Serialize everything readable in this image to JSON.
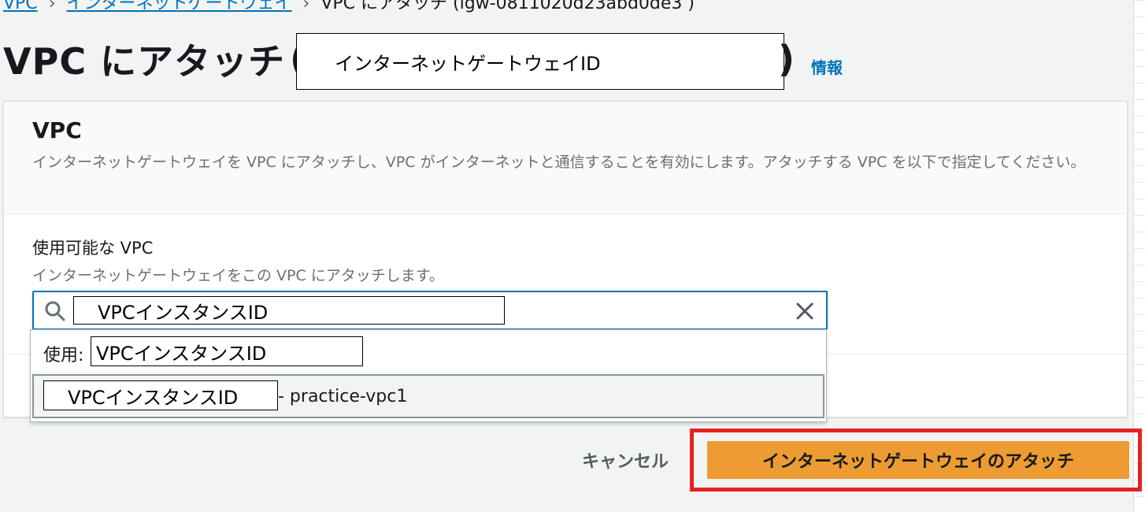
{
  "breadcrumb": {
    "items": [
      "VPC",
      "インターネットゲートウェイ",
      "VPC にアタッチ (igw-0811020d23abd0de3 )"
    ],
    "separator": "›"
  },
  "header": {
    "title": "VPC にアタッチ",
    "open_paren": "(",
    "close_paren": ")",
    "masked_id_label": "インターネットゲートウェイID",
    "info_link": "情報"
  },
  "panel": {
    "title": "VPC",
    "description": "インターネットゲートウェイを VPC にアタッチし、VPC がインターネットと通信することを有効にします。アタッチする VPC を以下で指定してください。",
    "field_label": "使用可能な VPC",
    "field_description": "インターネットゲートウェイをこの VPC にアタッチします。",
    "search_value_mask": "VPCインスタンスID"
  },
  "dropdown": {
    "group_label": "使用:",
    "group_mask": "VPCインスタンスID",
    "option_mask": "VPCインスタンスID",
    "option_suffix": "- practice-vpc1"
  },
  "footer": {
    "cancel_label": "キャンセル",
    "attach_label": "インターネットゲートウェイのアタッチ"
  },
  "colors": {
    "link": "#0073bb",
    "primary_button": "#ec9c32",
    "highlight": "#e52222",
    "focus_border": "#0073bb"
  },
  "icons": {
    "search": "search-icon",
    "clear": "close-icon"
  }
}
